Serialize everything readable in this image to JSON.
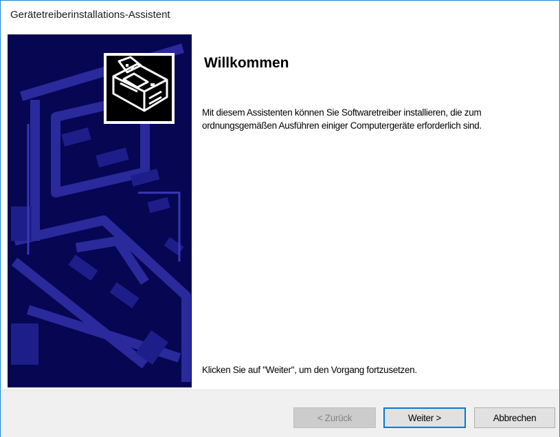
{
  "window": {
    "title": "Gerätetreiberinstallations-Assistent"
  },
  "banner": {
    "icon": "hardware-device-icon",
    "background_color": "#060653"
  },
  "content": {
    "heading": "Willkommen",
    "description": "Mit diesem Assistenten können Sie Softwaretreiber installieren, die zum ordnungsgemäßen Ausführen einiger Computergeräte erforderlich sind.",
    "footer": "Klicken Sie auf \"Weiter\", um den Vorgang fortzusetzen."
  },
  "buttons": {
    "back": "< Zurück",
    "next": "Weiter >",
    "cancel": "Abbrechen"
  },
  "colors": {
    "accent": "#0078d7",
    "window_border": "#1883d7"
  }
}
